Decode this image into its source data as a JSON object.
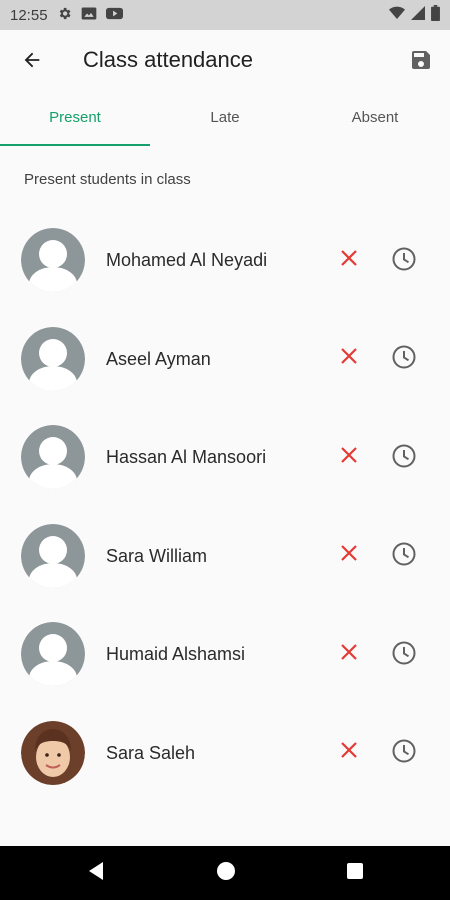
{
  "status_bar": {
    "time": "12:55",
    "icons": [
      "gear-icon",
      "gallery-icon",
      "youtube-icon",
      "wifi-icon",
      "signal-icon",
      "battery-icon"
    ]
  },
  "header": {
    "title": "Class attendance",
    "back_icon": "arrow-left-icon",
    "save_icon": "save-icon"
  },
  "tabs": [
    {
      "label": "Present",
      "active": true
    },
    {
      "label": "Late",
      "active": false
    },
    {
      "label": "Absent",
      "active": false
    }
  ],
  "section_label": "Present students in class",
  "students": [
    {
      "name": "Mohamed Al Neyadi",
      "avatar": "default-avatar"
    },
    {
      "name": "Aseel Ayman",
      "avatar": "default-avatar"
    },
    {
      "name": "Hassan Al Mansoori",
      "avatar": "default-avatar"
    },
    {
      "name": "Sara William",
      "avatar": "default-avatar"
    },
    {
      "name": "Humaid Alshamsi",
      "avatar": "default-avatar"
    },
    {
      "name": "Sara Saleh",
      "avatar": "photo-avatar"
    }
  ],
  "colors": {
    "accent": "#16a06b",
    "absent_mark": "#e53935",
    "avatar_placeholder": "#8d9699"
  }
}
